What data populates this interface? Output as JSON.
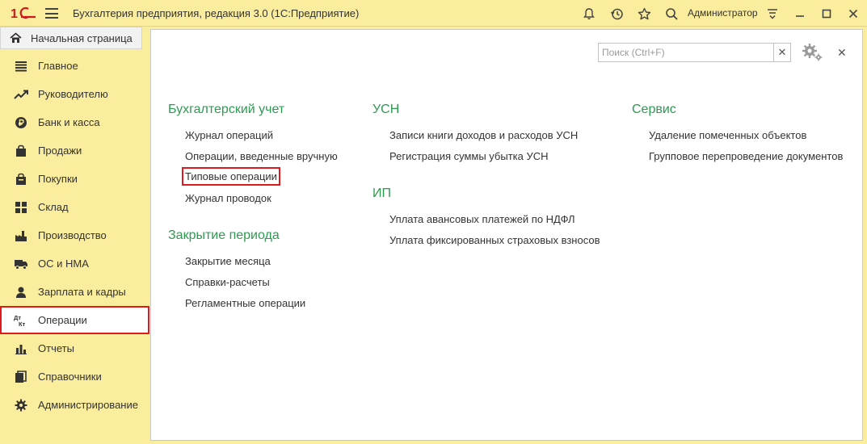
{
  "titlebar": {
    "logo_text": "1С",
    "app_title": "Бухгалтерия предприятия, редакция 3.0  (1С:Предприятие)",
    "user_name": "Администратор"
  },
  "home_tab": {
    "label": "Начальная страница"
  },
  "sidebar": {
    "items": [
      {
        "label": "Главное",
        "icon": "list-icon"
      },
      {
        "label": "Руководителю",
        "icon": "trend-icon"
      },
      {
        "label": "Банк и касса",
        "icon": "ruble-icon"
      },
      {
        "label": "Продажи",
        "icon": "bag-icon"
      },
      {
        "label": "Покупки",
        "icon": "cart-icon"
      },
      {
        "label": "Склад",
        "icon": "warehouse-icon"
      },
      {
        "label": "Производство",
        "icon": "factory-icon"
      },
      {
        "label": "ОС и НМА",
        "icon": "truck-icon"
      },
      {
        "label": "Зарплата и кадры",
        "icon": "person-icon"
      },
      {
        "label": "Операции",
        "icon": "dt-kt-icon",
        "active": true
      },
      {
        "label": "Отчеты",
        "icon": "bar-chart-icon"
      },
      {
        "label": "Справочники",
        "icon": "book-icon"
      },
      {
        "label": "Администрирование",
        "icon": "gear-icon"
      }
    ]
  },
  "search": {
    "placeholder": "Поиск (Ctrl+F)",
    "value": ""
  },
  "sections": {
    "accounting": {
      "title": "Бухгалтерский учет",
      "links": [
        "Журнал операций",
        "Операции, введенные вручную",
        "Типовые операции",
        "Журнал проводок"
      ]
    },
    "closing": {
      "title": "Закрытие периода",
      "links": [
        "Закрытие месяца",
        "Справки-расчеты",
        "Регламентные операции"
      ]
    },
    "usn": {
      "title": "УСН",
      "links": [
        "Записи книги доходов и расходов УСН",
        "Регистрация суммы убытка УСН"
      ]
    },
    "ip": {
      "title": "ИП",
      "links": [
        "Уплата авансовых платежей по НДФЛ",
        "Уплата фиксированных страховых взносов"
      ]
    },
    "service": {
      "title": "Сервис",
      "links": [
        "Удаление помеченных объектов",
        "Групповое перепроведение документов"
      ]
    }
  },
  "colors": {
    "background": "#FBED9E",
    "section_title": "#2E9A52",
    "highlight": "#E0191E",
    "logo": "#D0191E"
  }
}
